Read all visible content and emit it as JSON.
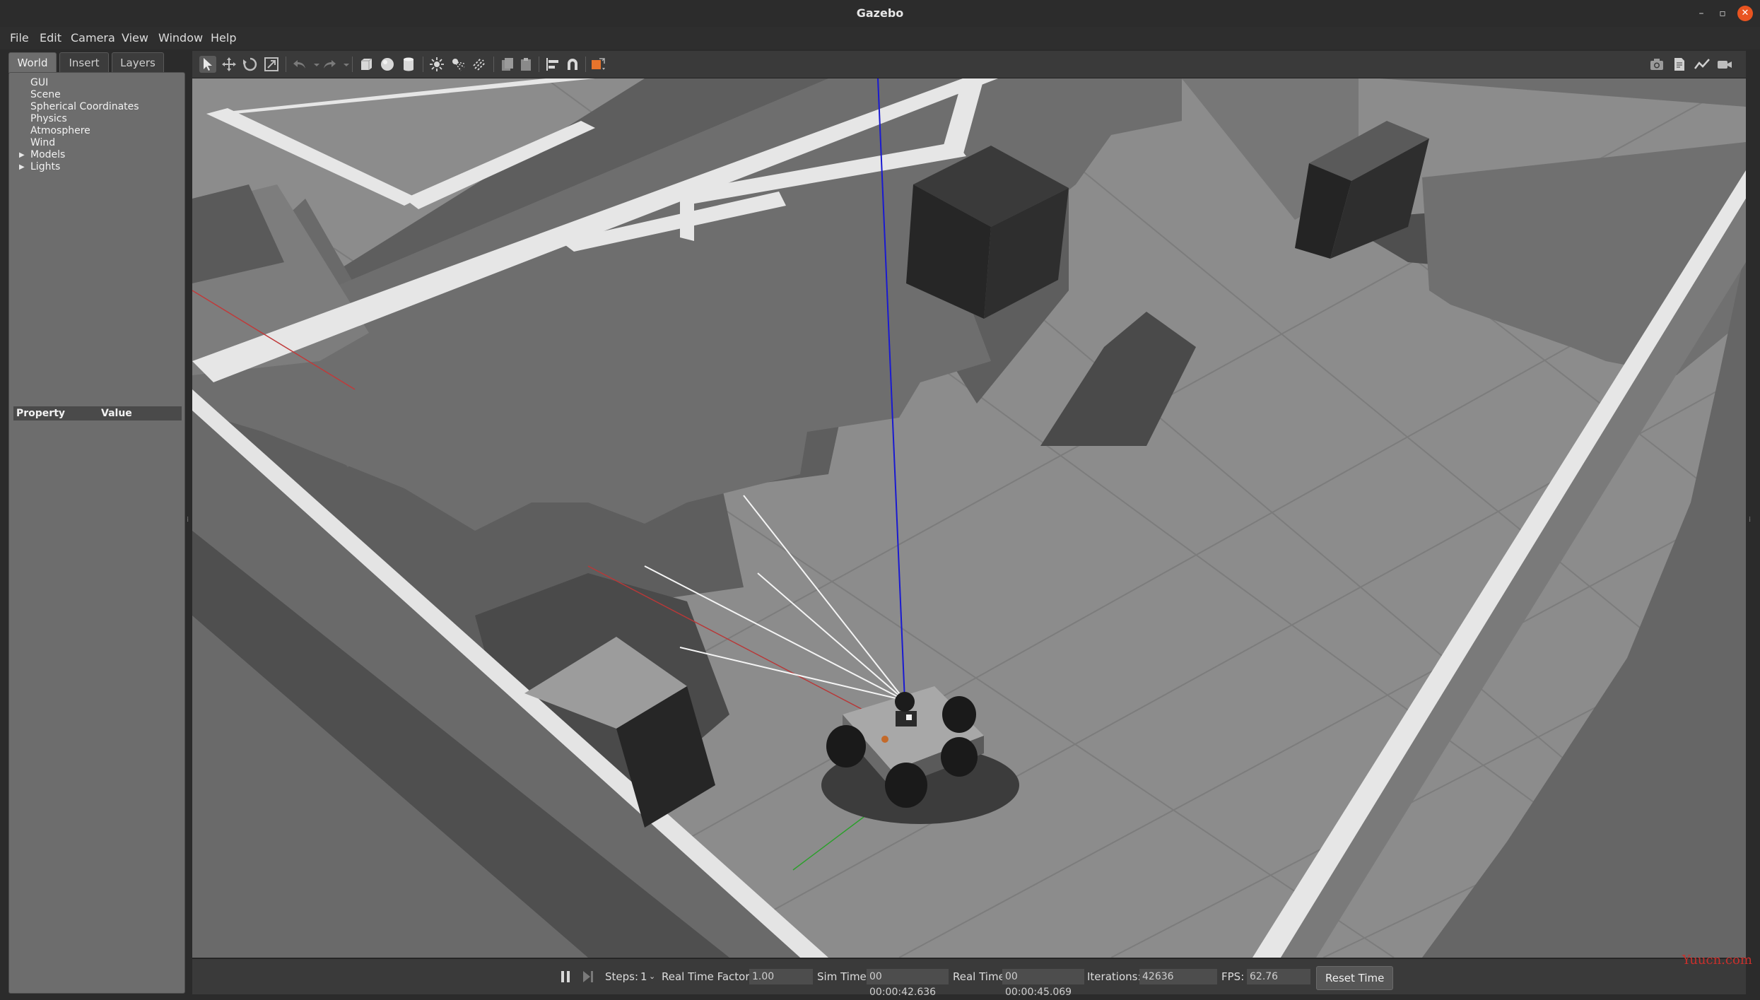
{
  "window": {
    "title": "Gazebo"
  },
  "menu": [
    "File",
    "Edit",
    "Camera",
    "View",
    "Window",
    "Help"
  ],
  "left_panel": {
    "tabs": [
      "World",
      "Insert",
      "Layers"
    ],
    "active_tab": "World",
    "tree": [
      {
        "label": "GUI",
        "expandable": false
      },
      {
        "label": "Scene",
        "expandable": false
      },
      {
        "label": "Spherical Coordinates",
        "expandable": false
      },
      {
        "label": "Physics",
        "expandable": false
      },
      {
        "label": "Atmosphere",
        "expandable": false
      },
      {
        "label": "Wind",
        "expandable": false
      },
      {
        "label": "Models",
        "expandable": true
      },
      {
        "label": "Lights",
        "expandable": true
      }
    ],
    "property_header": {
      "property": "Property",
      "value": "Value"
    }
  },
  "toolbar": {
    "tools": [
      "select-arrow-icon",
      "translate-icon",
      "rotate-icon",
      "scale-icon",
      "undo-icon",
      "redo-icon",
      "box-icon",
      "sphere-icon",
      "cylinder-icon",
      "point-light-icon",
      "spot-light-icon",
      "directional-light-icon",
      "copy-icon",
      "paste-icon",
      "align-icon",
      "snap-icon",
      "change-view-icon"
    ],
    "right_tools": [
      "screenshot-icon",
      "log-icon",
      "plot-icon",
      "record-icon"
    ]
  },
  "status": {
    "steps_label": "Steps:",
    "steps_value": "1",
    "rtf_label": "Real Time Factor:",
    "rtf_value": "1.00",
    "sim_time_label": "Sim Time:",
    "sim_time_value": "00 00:00:42.636",
    "real_time_label": "Real Time:",
    "real_time_value": "00 00:00:45.069",
    "iterations_label": "Iterations:",
    "iterations_value": "42636",
    "fps_label": "FPS:",
    "fps_value": "62.76",
    "reset_label": "Reset Time"
  },
  "watermark": "Yuucn.com",
  "colors": {
    "accent": "#e95420",
    "panel": "#6d6d6d",
    "ground": "#8b8b8b"
  }
}
